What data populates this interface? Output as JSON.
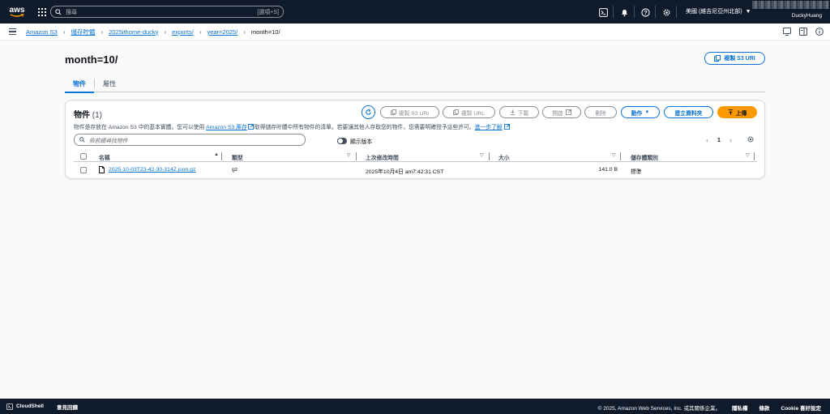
{
  "topnav": {
    "logo_text": "aws",
    "search_placeholder": "搜尋",
    "search_shortcut": "[選項+S]",
    "region": "美國 (維吉尼亞州北部)",
    "account_name": "DuckyHuang",
    "icons": [
      "cloudshell-icon",
      "bell-icon",
      "help-icon",
      "gear-icon"
    ]
  },
  "breadcrumb": {
    "items": [
      "Amazon S3",
      "儲存貯體",
      "2025ithome-ducky",
      "exports/",
      "year=2025/"
    ],
    "current": "month=10/"
  },
  "page": {
    "title": "month=10/",
    "copy_s3_uri_label": "複製 S3 URI",
    "tabs": [
      {
        "label": "物件",
        "active": true
      },
      {
        "label": "屬性",
        "active": false
      }
    ]
  },
  "objects_panel": {
    "title": "物件",
    "count": "(1)",
    "description_prefix": "物件是存放在 Amazon S3 中的基本實體。您可以使用 ",
    "description_link1": "Amazon S3 庫存",
    "description_middle": "取得儲存貯體中所有物件的清單。若要讓其他人存取您的物件，您需要明確授予這些許可。",
    "description_link2": "進一步了解",
    "buttons": {
      "copy_s3_uri": "複製 S3 URI",
      "copy_url": "複製 URL",
      "download": "下載",
      "open": "開啟",
      "delete": "刪除",
      "actions": "動作",
      "create_folder": "建立資料夾",
      "upload": "上傳"
    },
    "filter_placeholder": "依前綴尋找物件",
    "show_versions_label": "顯示版本",
    "page_number": "1",
    "columns": [
      "名稱",
      "類型",
      "上次修改時間",
      "大小",
      "儲存體類別"
    ],
    "rows": [
      {
        "name": "2025-10-03T23-42-30-314Z.json.gz",
        "type": "gz",
        "last_modified": "2025年10月4日 am7:42:31 CST",
        "size": "141.0 B",
        "storage_class": "標準"
      }
    ]
  },
  "footer": {
    "cloudshell": "CloudShell",
    "feedback": "意見回饋",
    "copyright": "© 2025, Amazon Web Services, Inc. 或其關係企業。",
    "privacy": "隱私權",
    "terms": "條款",
    "cookie": "Cookie 喜好設定"
  },
  "colors": {
    "nav_bg": "#0f1b2a",
    "link": "#0972d3",
    "upload": "#ff9900"
  }
}
